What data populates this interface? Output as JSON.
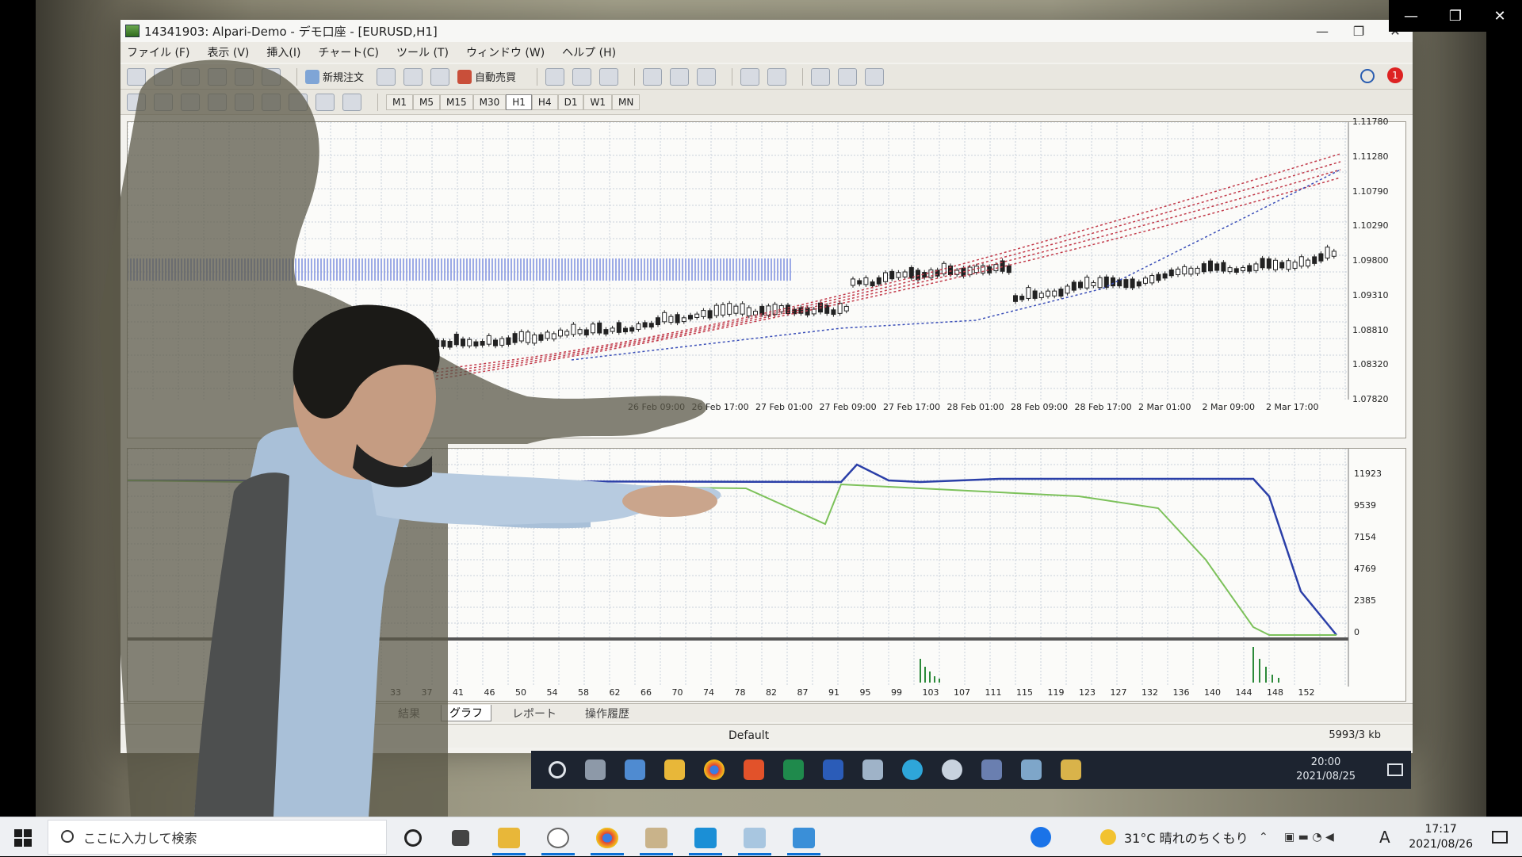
{
  "host_window": {
    "controls": {
      "minimize": "—",
      "restore": "❐",
      "close": "✕"
    }
  },
  "mt4": {
    "title": "14341903: Alpari-Demo - デモ口座 - [EURUSD,H1]",
    "controls": {
      "minimize": "—",
      "restore": "❐",
      "close": "✕"
    },
    "menu": [
      "ファイル (F)",
      "表示 (V)",
      "挿入(I)",
      "チャート(C)",
      "ツール (T)",
      "ウィンドウ (W)",
      "ヘルプ (H)"
    ],
    "toolbar": {
      "new_order": "新規注文",
      "auto_trade": "自動売買"
    },
    "timeframes": [
      "M1",
      "M5",
      "M15",
      "M30",
      "H1",
      "H4",
      "D1",
      "W1",
      "MN"
    ],
    "active_timeframe": "H1",
    "notification_count": "1",
    "price_axis": [
      "1.11780",
      "1.11280",
      "1.10790",
      "1.10290",
      "1.09800",
      "1.09310",
      "1.08810",
      "1.08320",
      "1.07820"
    ],
    "time_axis": [
      "26 Feb 09:00",
      "26 Feb 17:00",
      "27 Feb 01:00",
      "27 Feb 09:00",
      "27 Feb 17:00",
      "28 Feb 01:00",
      "28 Feb 09:00",
      "28 Feb 17:00",
      "2 Mar 01:00",
      "2 Mar 09:00",
      "2 Mar 17:00"
    ],
    "balance_axis": [
      "11923",
      "9539",
      "7154",
      "4769",
      "2385",
      "0"
    ],
    "trade_axis": [
      "33",
      "37",
      "41",
      "46",
      "50",
      "54",
      "58",
      "62",
      "66",
      "70",
      "74",
      "78",
      "82",
      "87",
      "91",
      "95",
      "99",
      "103",
      "107",
      "111",
      "115",
      "119",
      "123",
      "127",
      "132",
      "136",
      "140",
      "144",
      "148",
      "152"
    ],
    "bottom_tabs": [
      "結果",
      "グラフ",
      "レポート",
      "操作履歴"
    ],
    "active_bottom_tab": "グラフ",
    "status": {
      "profile": "Default",
      "traffic": "5993/3 kb"
    },
    "inner_clock": {
      "time": "20:00",
      "date": "2021/08/25"
    },
    "colors": {
      "balance_line": "#2b3fa8",
      "equity_line": "#7cc15a",
      "ma_dots": "#c23b4b"
    }
  },
  "taskbar": {
    "search_placeholder": "ここに入力して検索",
    "weather": "31°C  晴れのちくもり",
    "ime": "A",
    "time": "17:17",
    "date": "2021/08/26"
  }
}
